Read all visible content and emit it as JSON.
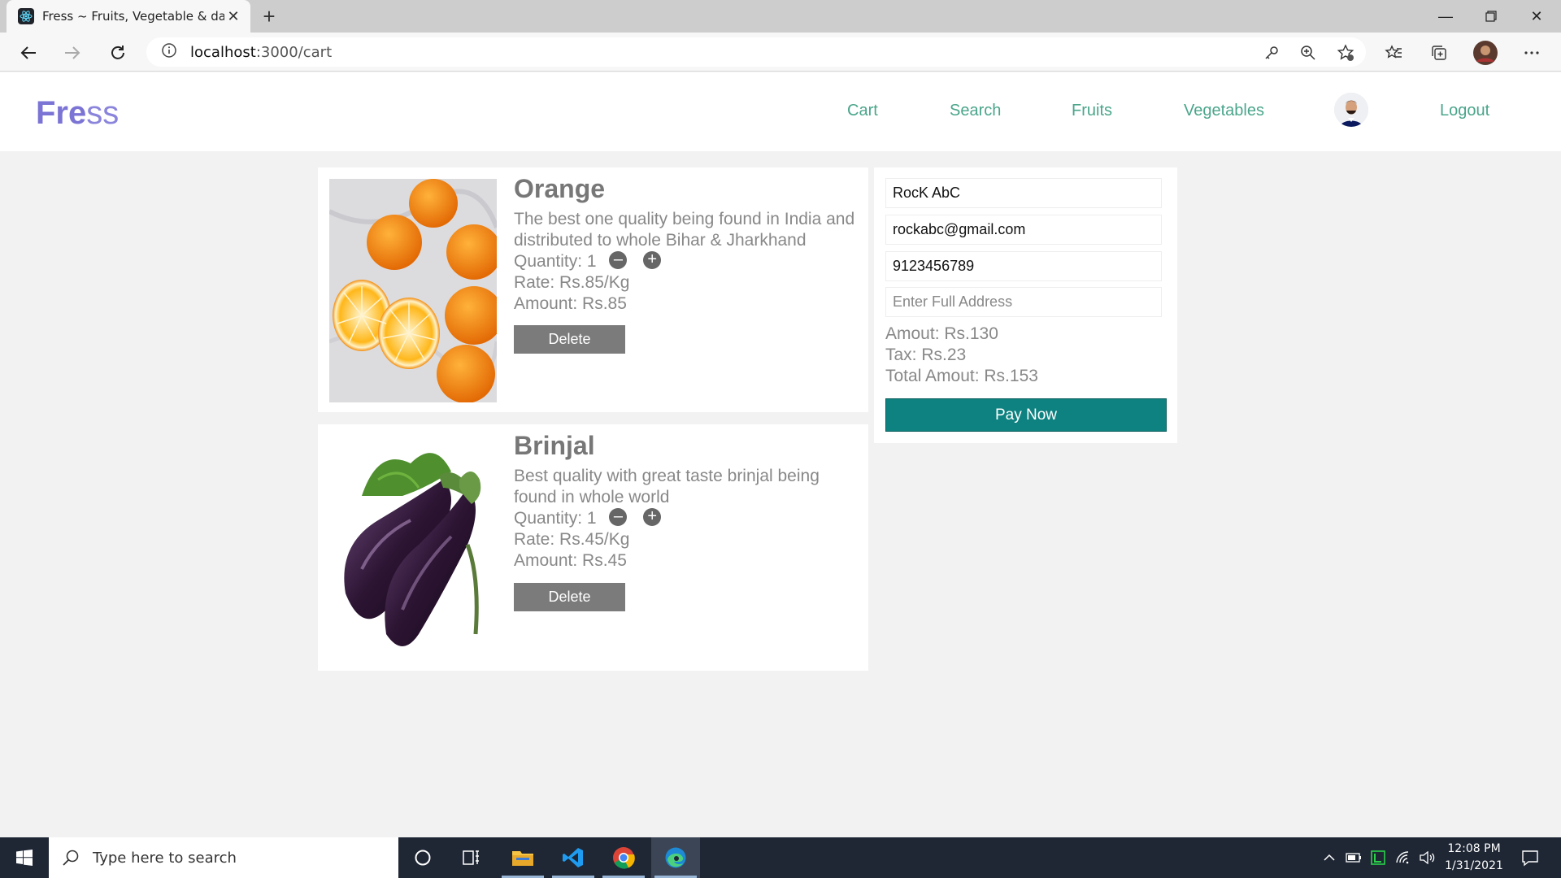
{
  "browser": {
    "tab_title": "Fress ~ Fruits, Vegetable & daily",
    "url_host": "localhost",
    "url_path": ":3000/cart"
  },
  "app": {
    "brand_bold": "Fre",
    "brand_light": "ss",
    "nav": [
      "Cart",
      "Search",
      "Fruits",
      "Vegetables",
      "Logout"
    ],
    "nav_color": "#4aa58a",
    "brand_color": "#7b74d4"
  },
  "cart": {
    "items": [
      {
        "name": "Orange",
        "description": "The best one quality being found in India and distributed to whole Bihar & Jharkhand",
        "quantity": "Quantity: 1",
        "rate": "Rate: Rs.85/Kg",
        "amount": "Amount: Rs.85",
        "delete_label": "Delete"
      },
      {
        "name": "Brinjal",
        "description": "Best quality with great taste brinjal being found in whole world",
        "quantity": "Quantity: 1",
        "rate": "Rate: Rs.45/Kg",
        "amount": "Amount: Rs.45",
        "delete_label": "Delete"
      }
    ]
  },
  "checkout": {
    "name_value": "RocK AbC",
    "email_value": "rockabc@gmail.com",
    "phone_value": "9123456789",
    "address_placeholder": "Enter Full Address",
    "amount": "Amout: Rs.130",
    "tax": "Tax: Rs.23",
    "total": "Total Amout: Rs.153",
    "pay_label": "Pay Now",
    "pay_color": "#0e8280"
  },
  "taskbar": {
    "search_placeholder": "Type here to search",
    "time": "12:08 PM",
    "date": "1/31/2021"
  }
}
